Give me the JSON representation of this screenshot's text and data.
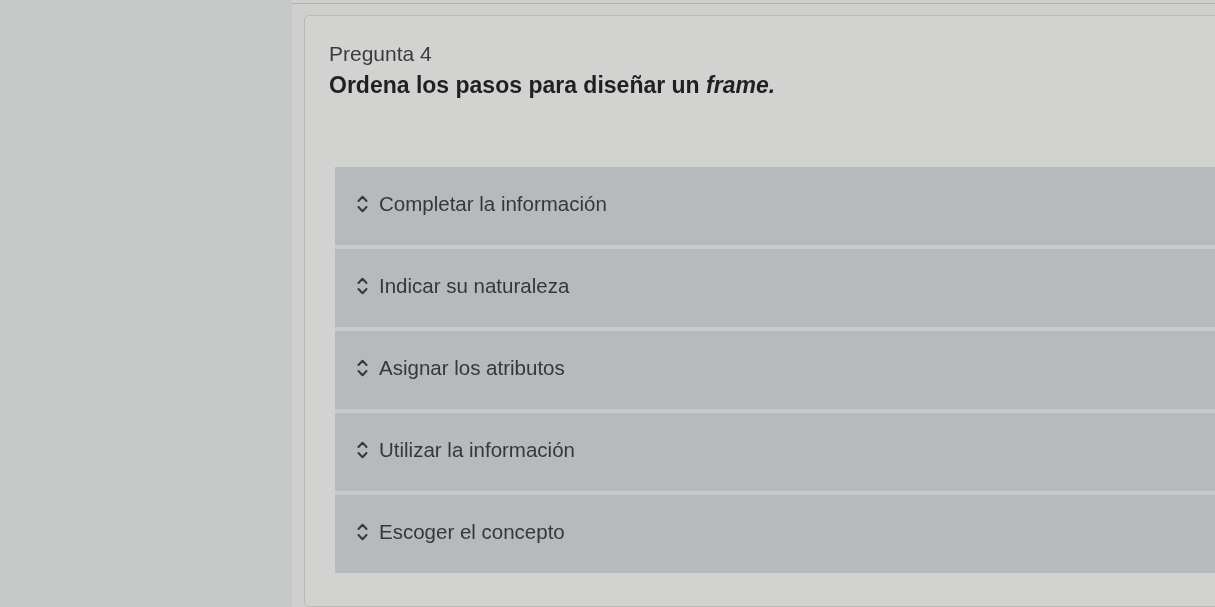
{
  "question": {
    "label": "Pregunta 4",
    "text": "Ordena los pasos para diseñar un *frame.*"
  },
  "items": [
    {
      "label": "Completar la información"
    },
    {
      "label": "Indicar su naturaleza"
    },
    {
      "label": "Asignar los atributos"
    },
    {
      "label": "Utilizar la información"
    },
    {
      "label": "Escoger el concepto"
    }
  ]
}
